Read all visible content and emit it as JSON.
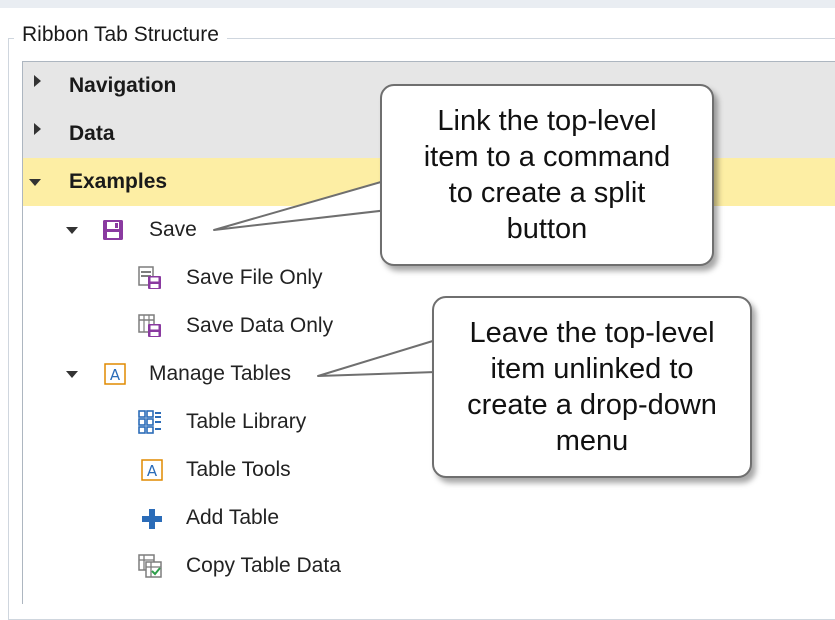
{
  "group_title": "Ribbon Tab Structure",
  "tree": {
    "navigation": "Navigation",
    "data": "Data",
    "examples": "Examples",
    "save": "Save",
    "save_file_only": "Save File Only",
    "save_data_only": "Save Data Only",
    "manage_tables": "Manage Tables",
    "table_library": "Table Library",
    "table_tools": "Table Tools",
    "add_table": "Add Table",
    "copy_table_data": "Copy Table Data"
  },
  "callouts": {
    "split_button": "Link the top-level item to a command to create a split button",
    "drop_down": "Leave the top-level item unlinked to create a drop-down menu"
  },
  "icons": {
    "save": "floppy-disk-icon",
    "save_file_only": "save-file-icon",
    "save_data_only": "save-data-icon",
    "manage_tables": "table-text-icon",
    "table_library": "table-grid-icon",
    "table_tools": "table-text-icon",
    "add_table": "plus-icon",
    "copy_table_data": "copy-table-icon"
  },
  "colors": {
    "selected_row": "#fdeea4",
    "top_row": "#e6e6e6",
    "save_icon": "#8a3aa0",
    "table_icon": "#2b6cb8",
    "table_text_icon": "#e08a00"
  }
}
